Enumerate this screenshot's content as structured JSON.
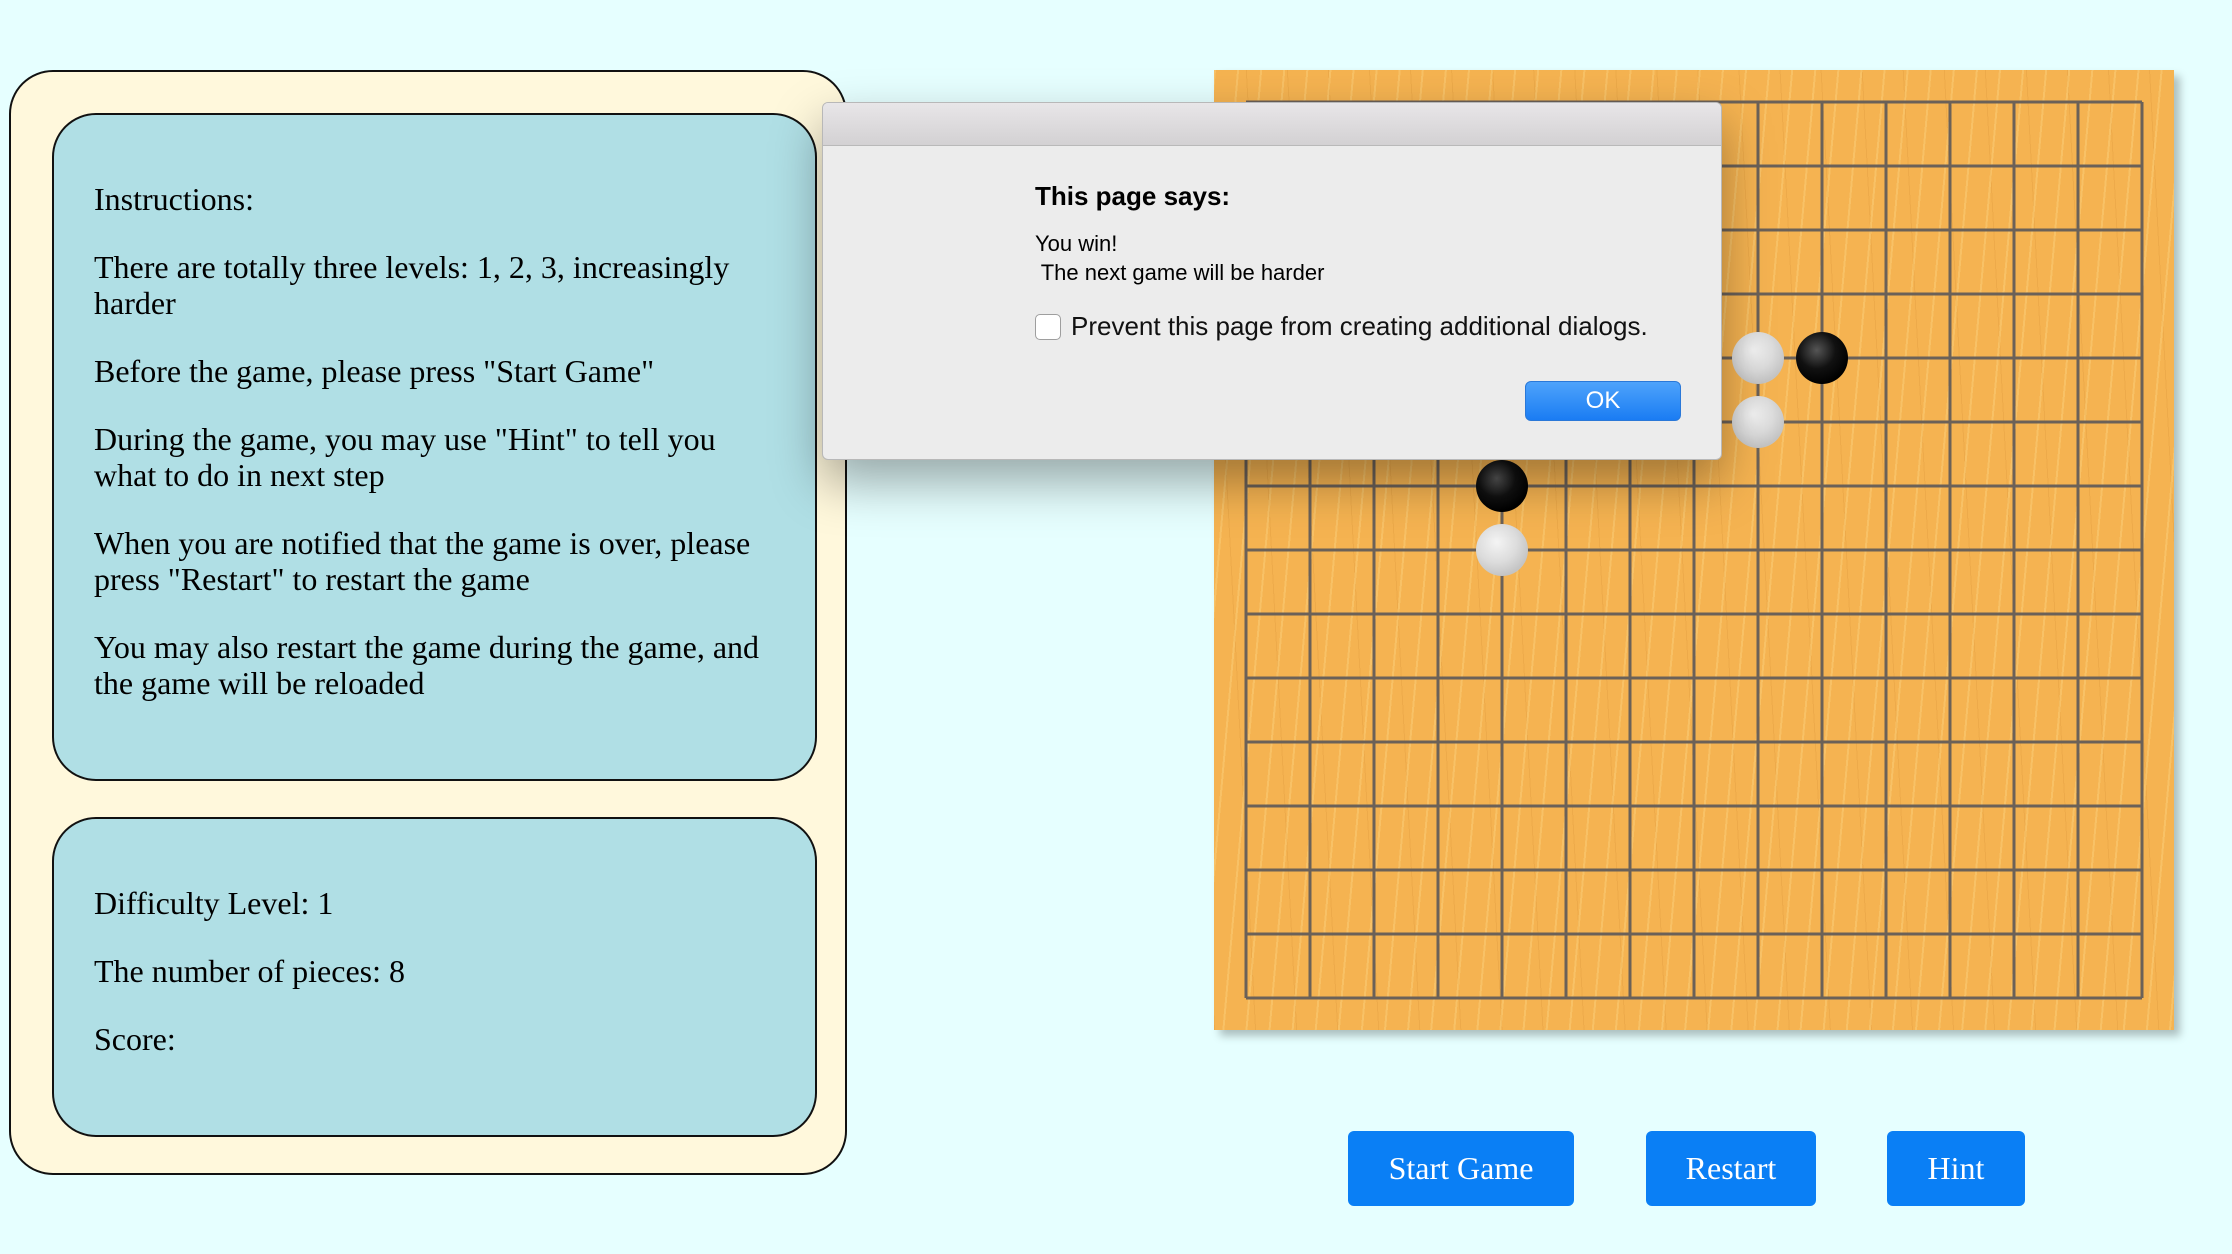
{
  "instructions": {
    "heading": "Instructions:",
    "paragraphs": [
      "There are totally three levels: 1, 2, 3, increasingly harder",
      "Before the game, please press \"Start Game\"",
      "During the game, you may use \"Hint\" to tell you what to do in next step",
      "When you are notified that the game is over, please press \"Restart\" to restart the game",
      "You may also restart the game during the game, and the game will be reloaded"
    ]
  },
  "status": {
    "difficulty": "Difficulty Level: 1",
    "pieces": "The number of pieces: 8",
    "score": "Score:"
  },
  "board": {
    "size": 15,
    "stones": [
      {
        "col": 8,
        "row": 4,
        "color": "white"
      },
      {
        "col": 9,
        "row": 4,
        "color": "black"
      },
      {
        "col": 8,
        "row": 5,
        "color": "white"
      },
      {
        "col": 4,
        "row": 6,
        "color": "black"
      },
      {
        "col": 4,
        "row": 7,
        "color": "white"
      }
    ]
  },
  "dialog": {
    "heading": "This page says:",
    "message": "You win!\n The next game will be harder",
    "checkbox_label": "Prevent this page from creating additional dialogs.",
    "ok_label": "OK"
  },
  "buttons": {
    "start": "Start Game",
    "restart": "Restart",
    "hint": "Hint"
  },
  "colors": {
    "page_bg": "#e6ffff",
    "panel_bg": "#fff8dc",
    "card_bg": "#b0dfe5",
    "board_bg": "#f5b351",
    "button_bg": "#0a7ff5"
  }
}
